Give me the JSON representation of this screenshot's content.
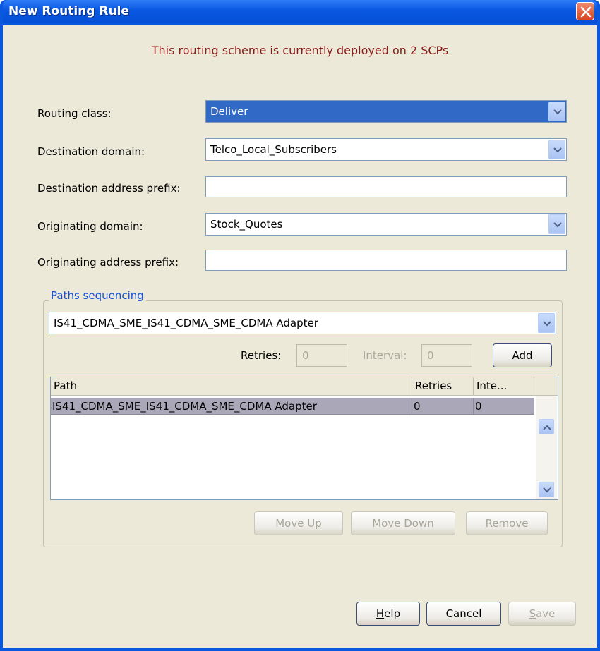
{
  "window": {
    "title": "New Routing Rule",
    "notice": "This routing scheme is currently deployed on 2 SCPs"
  },
  "form": {
    "routing_class": {
      "label": "Routing class:",
      "value": "Deliver"
    },
    "destination_domain": {
      "label": "Destination domain:",
      "value": "Telco_Local_Subscribers"
    },
    "destination_address_prefix": {
      "label": "Destination address prefix:",
      "value": ""
    },
    "originating_domain": {
      "label": "Originating domain:",
      "value": "Stock_Quotes"
    },
    "originating_address_prefix": {
      "label": "Originating address prefix:",
      "value": ""
    }
  },
  "paths": {
    "legend": "Paths sequencing",
    "selected_path": "IS41_CDMA_SME_IS41_CDMA_SME_CDMA Adapter",
    "retries_label": "Retries:",
    "retries_value": "0",
    "interval_label": "Interval:",
    "interval_value": "0",
    "add_button": {
      "pre": "",
      "mnemonic": "A",
      "post": "dd"
    },
    "table": {
      "columns": [
        "Path",
        "Retries",
        "Inte..."
      ],
      "rows": [
        [
          "IS41_CDMA_SME_IS41_CDMA_SME_CDMA Adapter",
          "0",
          "0"
        ]
      ]
    },
    "move_up": {
      "pre": "Move ",
      "mnemonic": "U",
      "post": "p"
    },
    "move_down": {
      "pre": "Move ",
      "mnemonic": "D",
      "post": "own"
    },
    "remove": {
      "pre": "",
      "mnemonic": "R",
      "post": "emove"
    }
  },
  "footer": {
    "help": {
      "pre": "",
      "mnemonic": "H",
      "post": "elp"
    },
    "cancel": "Cancel",
    "save": {
      "pre": "",
      "mnemonic": "S",
      "post": "ave"
    }
  },
  "colors": {
    "notice": "#8b1a1a",
    "legend": "#1550dc",
    "selection": "#3169c6",
    "row_selected": "#aaa8b8"
  },
  "icons": [
    "close-icon",
    "chevron-down-icon",
    "chevron-up-icon"
  ]
}
